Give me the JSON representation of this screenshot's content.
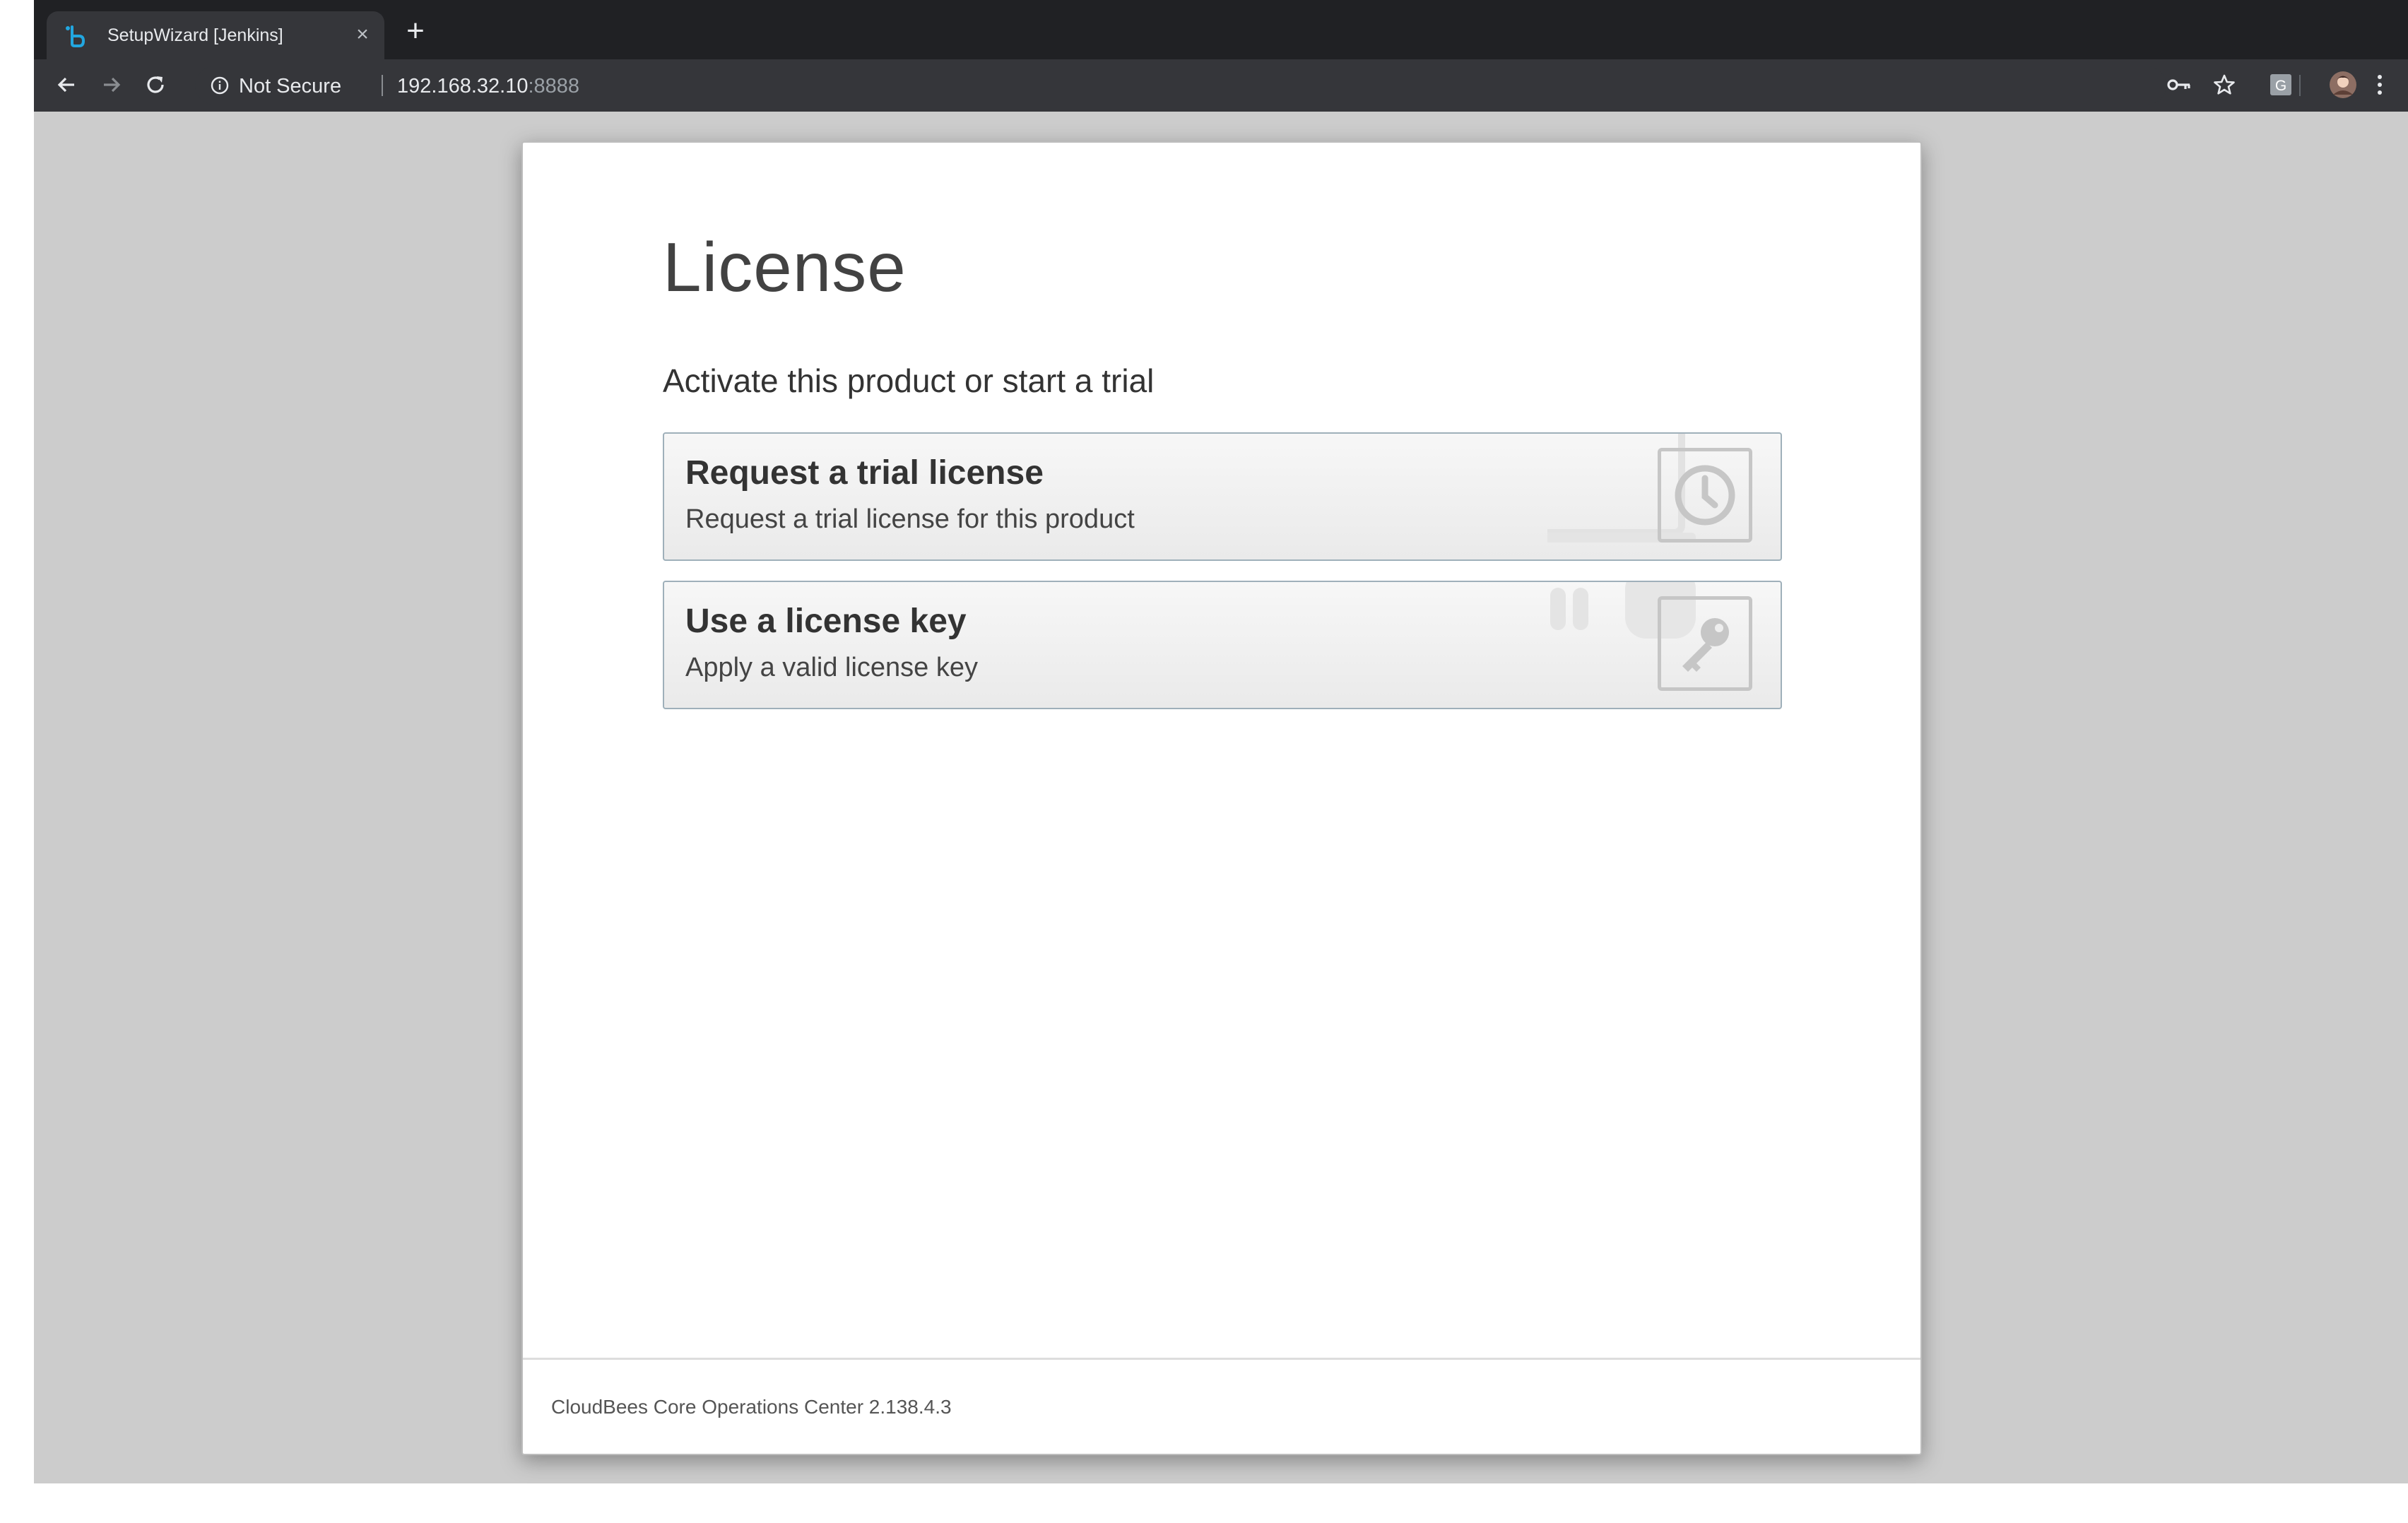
{
  "browser": {
    "tab_title": "SetupWizard [Jenkins]",
    "tab_close_icon": "close-icon",
    "new_tab_icon": "plus-icon",
    "security_label": "Not Secure",
    "url_host": "192.168.32.10",
    "url_port": ":8888",
    "toolbar_icons": [
      "back-arrow-icon",
      "forward-arrow-icon",
      "reload-icon",
      "info-icon",
      "key-icon",
      "star-icon",
      "extension-g-icon",
      "avatar",
      "kebab-menu-icon"
    ],
    "extension_letter": "G"
  },
  "page": {
    "title": "License",
    "subtitle": "Activate this product or start a trial",
    "options": [
      {
        "title": "Request a trial license",
        "description": "Request a trial license for this product",
        "icon": "clock-icon"
      },
      {
        "title": "Use a license key",
        "description": "Apply a valid license key",
        "icon": "key-icon"
      }
    ],
    "footer": "CloudBees Core Operations Center 2.138.4.3"
  },
  "colors": {
    "chrome_dark": "#202124",
    "chrome_toolbar": "#35363a",
    "viewport_bg": "#cccccc",
    "favicon_accent": "#22a7e0",
    "option_border": "#9fb0ba"
  }
}
